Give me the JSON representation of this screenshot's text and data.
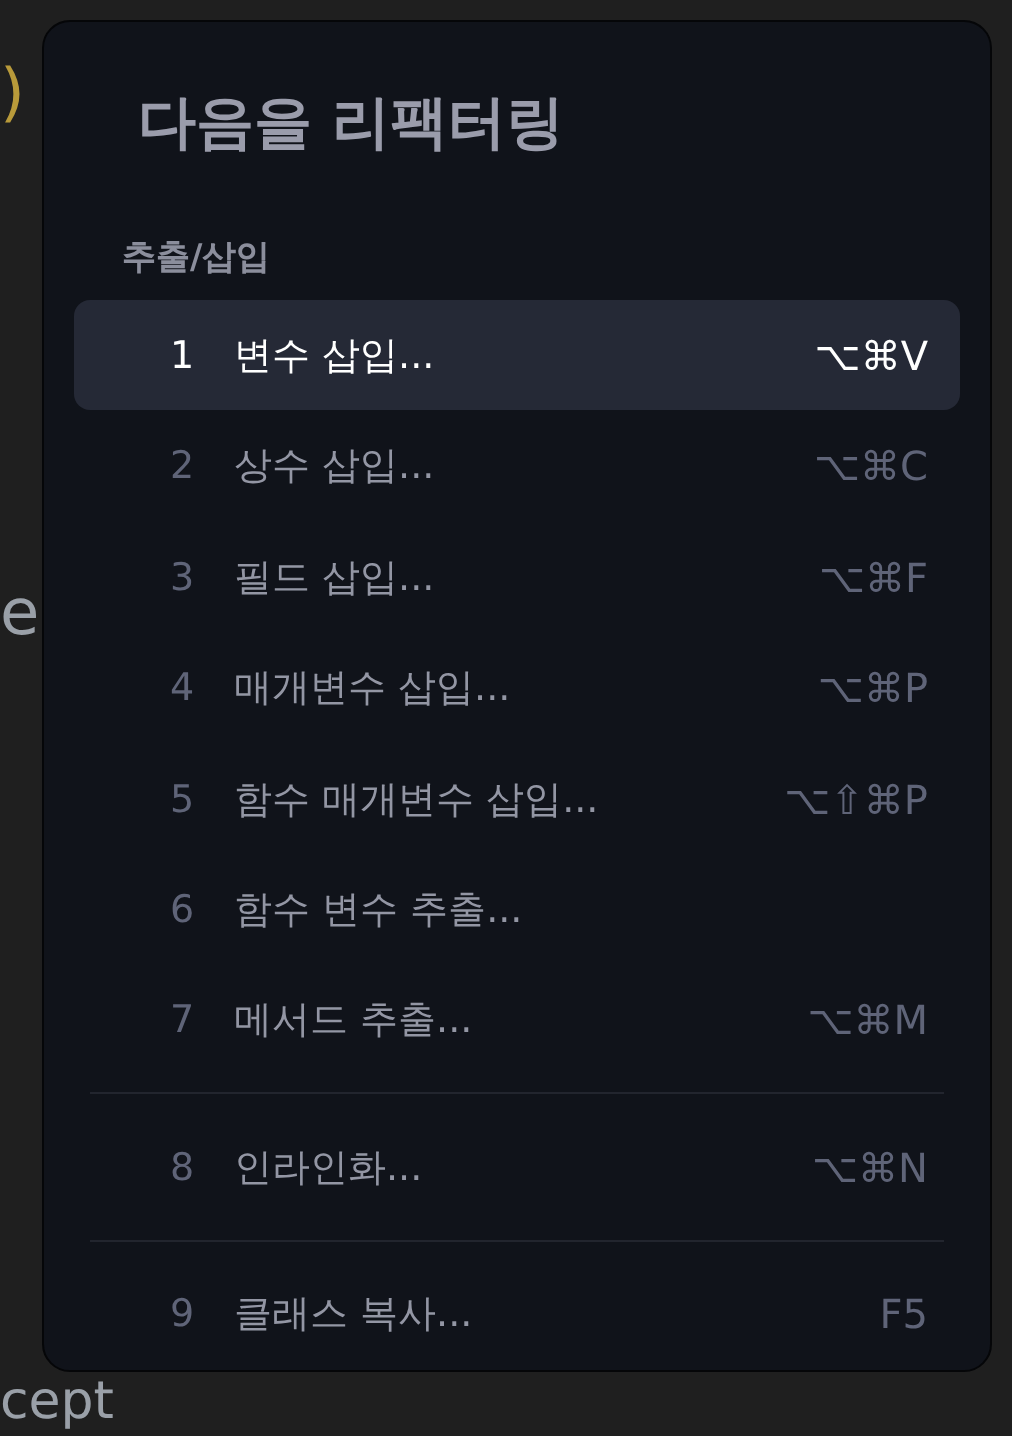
{
  "editor_background": {
    "fragments": [
      {
        "text": ")",
        "kind": "paren"
      },
      {
        "text": "e",
        "kind": "word"
      },
      {
        "text": "cept",
        "kind": "word"
      }
    ]
  },
  "popup": {
    "title": "다음을 리팩터링",
    "section": "추출/삽입",
    "groups": [
      [
        {
          "number": "1",
          "label": "변수 삽입...",
          "shortcut": "⌥⌘V",
          "selected": true
        },
        {
          "number": "2",
          "label": "상수 삽입...",
          "shortcut": "⌥⌘C",
          "selected": false
        },
        {
          "number": "3",
          "label": "필드 삽입...",
          "shortcut": "⌥⌘F",
          "selected": false
        },
        {
          "number": "4",
          "label": "매개변수 삽입...",
          "shortcut": "⌥⌘P",
          "selected": false
        },
        {
          "number": "5",
          "label": "함수 매개변수 삽입...",
          "shortcut": "⌥⇧⌘P",
          "selected": false
        },
        {
          "number": "6",
          "label": "함수 변수 추출...",
          "selected": false
        },
        {
          "number": "7",
          "label": "메서드 추출...",
          "shortcut": "⌥⌘M",
          "selected": false
        }
      ],
      [
        {
          "number": "8",
          "label": "인라인화...",
          "shortcut": "⌥⌘N",
          "selected": false
        }
      ],
      [
        {
          "number": "9",
          "label": "클래스 복사...",
          "shortcut": "F5",
          "selected": false
        }
      ]
    ]
  }
}
